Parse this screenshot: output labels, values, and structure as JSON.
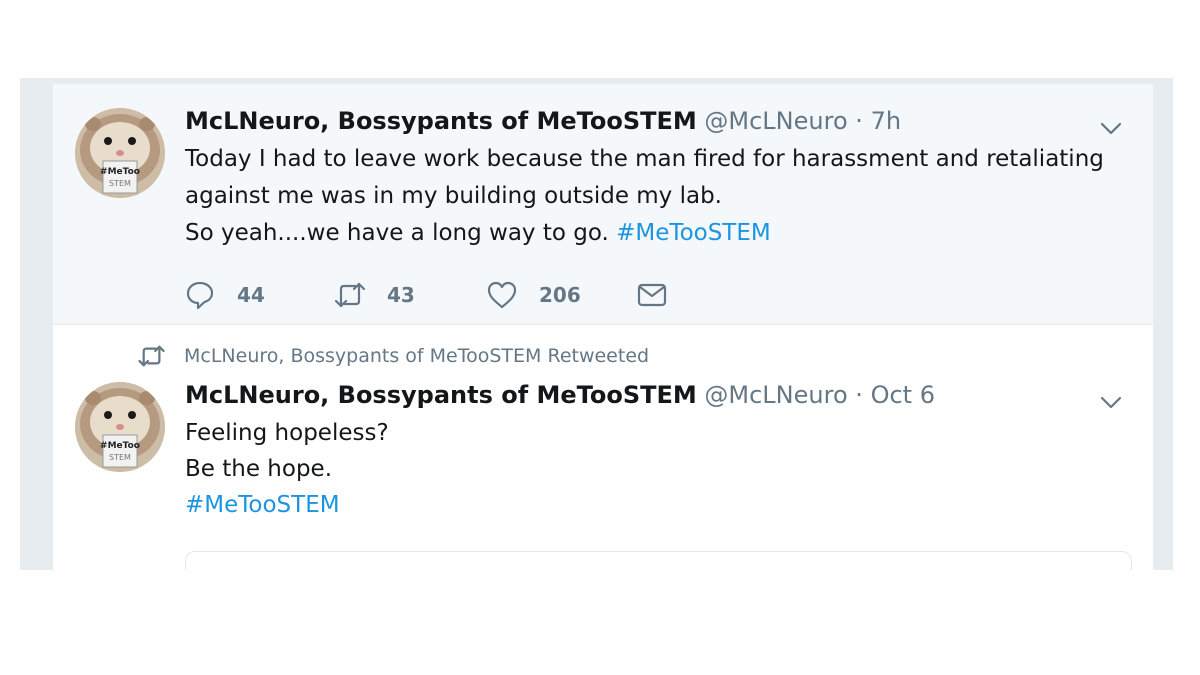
{
  "tweets": [
    {
      "author_name": "McLNeuro, Bossypants of MeTooSTEM",
      "handle": "@McLNeuro",
      "separator": "·",
      "time": "7h",
      "avatar_icon": "hamster-avatar-icon",
      "avatar_badge": [
        "#MeToo",
        "STEM"
      ],
      "lines": [
        "Today I had to leave work because the man fired for harassment and retaliating",
        "against me was in my building outside my lab.",
        "So yeah....we have a long way to go. "
      ],
      "hashtag": "#MeTooSTEM",
      "actions": {
        "replies": "44",
        "retweets": "43",
        "likes": "206"
      }
    },
    {
      "retweet_context": "McLNeuro, Bossypants of MeTooSTEM Retweeted",
      "author_name": "McLNeuro, Bossypants of MeTooSTEM",
      "handle": "@McLNeuro",
      "separator": "·",
      "time": "Oct 6",
      "avatar_icon": "hamster-avatar-icon",
      "avatar_badge": [
        "#MeToo",
        "STEM"
      ],
      "lines": [
        "Feeling hopeless?",
        "Be the hope."
      ],
      "hashtag": "#MeTooSTEM"
    }
  ],
  "colors": {
    "link": "#1b95e0",
    "secondary_text": "#657786",
    "primary_text": "#14171a",
    "highlight_bg": "#f5f8fa",
    "frame_bg": "#e6ecf0"
  }
}
